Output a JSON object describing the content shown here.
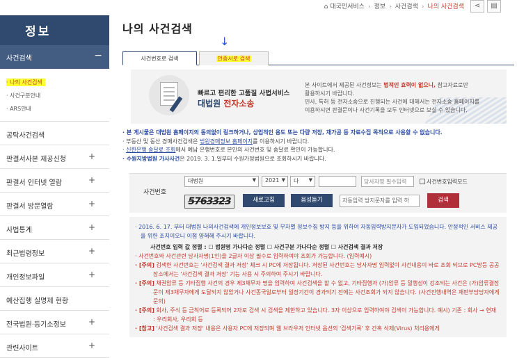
{
  "breadcrumb": {
    "home": "⌂ 대국민서비스",
    "level2": "정보",
    "level3": "사건검색",
    "current": "나의 사건검색"
  },
  "toolbar": {
    "share_icon": "share-icon",
    "print_icon": "print-icon"
  },
  "sidebar": {
    "title": "정보",
    "active_menu": "사건검색",
    "active_symbol": "−",
    "submenu": [
      "· 나의 사건검색",
      "· 사건구분안내",
      "· ARS안내"
    ],
    "items": [
      {
        "label": "공탁사건검색",
        "plus": ""
      },
      {
        "label": "판결서사본 제공신청",
        "plus": "+"
      },
      {
        "label": "판결서 인터넷 열람",
        "plus": "+"
      },
      {
        "label": "판결서 방문열람",
        "plus": "+"
      },
      {
        "label": "사법통계",
        "plus": "+"
      },
      {
        "label": "최근법령정보",
        "plus": "+"
      },
      {
        "label": "개인정보파일",
        "plus": "+"
      },
      {
        "label": "예산집행 실명제 현황",
        "plus": ""
      },
      {
        "label": "전국법원·등기소정보",
        "plus": "+"
      },
      {
        "label": "관련사이트",
        "plus": "+"
      }
    ]
  },
  "page_title": "나의 사건검색",
  "tabs": {
    "tab1": "사건번호로 검색",
    "tab2": "인증서로 검색"
  },
  "arrow": "↓",
  "banner": {
    "left1": "빠르고 편리한 고품질 사법서비스",
    "left2a": "대법원 ",
    "left2b": "전자소송",
    "r1a": "본 사이트에서 제공된 사건정보는 ",
    "r1b": "법적인 효력이 없으니,",
    "r1c": " 참고자료로만",
    "r2": "활용하시기 바랍니다.",
    "r3": "민사, 특허 등 전자소송으로 진행되는 사건에 대해서는 전자소송 홈페이지를",
    "r4": "이용하시면 판결문이나 사건기록을 모두 인터넷으로 보실 수 있습니다."
  },
  "notice": {
    "l1": "· 본 게시물은 대법원 홈페이지의 동의없이 링크하거나, 상업적인 용도 또는 다량 저장, 재가공 등 자료수집 목적으로 사용할 수 없습니다.",
    "l2a": "· 부동산 및 동산 경매사건검색은 ",
    "l2b": "법원경매정보 홈페이지",
    "l2c": "를 이용하시기 바랍니다.",
    "l3a": "· ",
    "l3b": "신한은행 송달료 조회",
    "l3c": "에서 예납 은행번호로 본인의 사건번호 및 송달료 확인이 가능합니다.",
    "l4a": "· 수원지방법원 가사사건",
    "l4b": "은 2019. 3. 1.일부터 수원가정법원으로 조회하시기 바랍니다."
  },
  "search": {
    "label": "사건번호",
    "court": "대법원",
    "year": "2021",
    "type": "다",
    "number": "",
    "party_placeholder": "당사자명 필수입력",
    "checkbox_label": "사건번호입력모드",
    "captcha": "5763323",
    "refresh": "새로고침",
    "audio": "음성듣기",
    "captcha_placeholder": "자동입력 방지문자를 입력 하",
    "search_btn": "검색"
  },
  "info": {
    "p1": "· 2016. 6. 17. 부터 대법원 나의사건검색에 개인정보보호 및 무차별 정보수집 방지 등을 위하여 자동입력방지문자가 도입되었습니다. 안정적인 서비스 제공을 위한 조치이오니 이점 양해해 주시기 바랍니다.",
    "p2a": "사건번호 입력 값 정렬 : ",
    "p2b": "☐ 법원명 가나다순 정렬  ☐ 사건구분 가나다순 정렬  ☐ 사건검색 결과 저장",
    "p3": "· 사건번호와 사건관련 당사자명(1인)을 2글자 이상 필수로 입력하여야 조회가 가능합니다. (입력예시)",
    "p4tag": "· [주의]",
    "p4": " 검색한 사건번호는 '사건검색 결과 저장' 체크 시 PC에 저장됩니다. 저장된 사건번호는 당사자명 입력없이 사건내용이 바로 조회 되므로 PC방등 공공장소에서는 '사건검색 결과 저장' 기능 사용 시 주의하여 주시기 바랍니다.",
    "p5tag": "· [주의]",
    "p5": " 채권압류 등 기타집행 사건의 경우 제3채무자 명을 입력하여 사건검색을 할 수 없고, 기타집행과 (가)압류 등 밀행성이 강조되는 사건은 (가)압류결정문이 제3채무자에게 도달되지 않았거나 사건종국일로부터 일정기간이 경과되기 전에는 사건조회가 되지 않습니다. (사건진행내역은 재판부담당자에게 문의)",
    "p6tag": "· [주의]",
    "p6": " 회사, 주식 등 금칙어로 등록되어 2자로 검색 시 검색을 제한하고 있습니다. 3자 이상으로 입력하여야 검색이 가능합니다. 예시) 기존 : 회사 → 현재 : 우리회사, 우리회 등",
    "p7tag": "· [참고]",
    "p7": " '사건검색 결과 저장' 내용은 사용자 PC에 저장되며 웹 브라우저 인터넷 옵션의 '검색기록' 후 간혹 삭제(Virus) 처리용에게"
  }
}
